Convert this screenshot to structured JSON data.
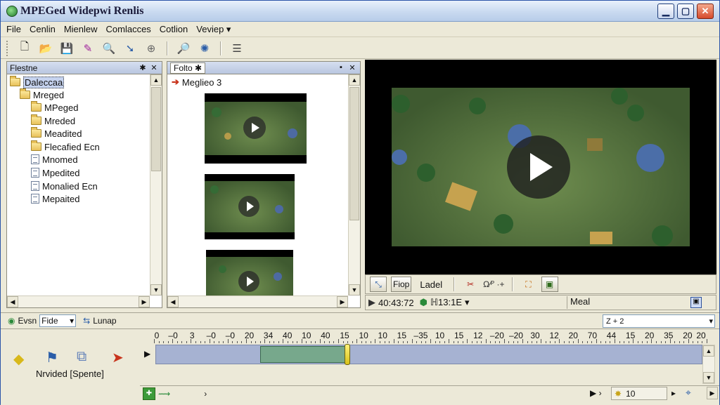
{
  "window": {
    "title": "MPEGed Widepwi Renlis"
  },
  "menu": [
    "File",
    "Cenlin",
    "Mienlew",
    "Comlacces",
    "Cotlion",
    "Veviep ▾"
  ],
  "toolbar": {
    "icons": [
      "new-file-icon",
      "open-icon",
      "save-icon",
      "wizard-icon",
      "search-icon",
      "pick-icon",
      "zoom-icon",
      "zoom-in-icon",
      "effect-icon",
      "list-icon"
    ]
  },
  "left_panel": {
    "title": "Flestne",
    "items": [
      "Daleccaa",
      "Mreged",
      "MPeged",
      "Mreded",
      "Meadited",
      "Flecafied Ecn",
      "Mnomed",
      "Mpedited",
      "Monalied Ecn",
      "Mepaited"
    ]
  },
  "middle_panel": {
    "tab": "Folto",
    "item": "Meglieo 3"
  },
  "player_controls": {
    "btn_files": "Fiop",
    "btn_label": "Ladel",
    "btn_effects": "Ω⁄ᴾ ·+"
  },
  "status": {
    "time1": "40:43:72",
    "time2": "ℍ13:1E",
    "mode": "Meal"
  },
  "filter_bar": {
    "label": "Evsn",
    "combo_value": "Fide",
    "link": "Lunap",
    "field": "Z  +       2"
  },
  "timeline": {
    "ruler_labels": [
      "0",
      "–0",
      "3",
      "–0",
      "–0",
      "20",
      "34",
      "40",
      "10",
      "40",
      "15",
      "10",
      "10",
      "15",
      "–35",
      "10",
      "15",
      "12",
      "–20",
      "–20",
      "30",
      "12",
      "20",
      "70",
      "44",
      "15",
      "20",
      "35",
      "20",
      "20"
    ],
    "label": "Nrvided [Spente]",
    "zoom_value": "10"
  }
}
